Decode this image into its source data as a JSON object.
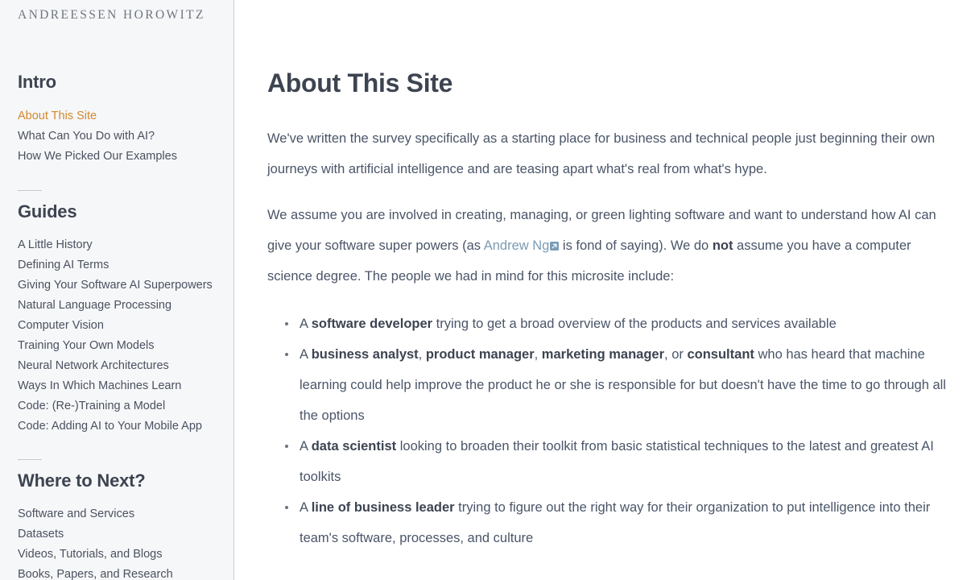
{
  "sidebar": {
    "logo": "ANDREESSEN HOROWITZ",
    "sections": [
      {
        "title": "Intro",
        "items": [
          {
            "label": "About This Site",
            "active": true
          },
          {
            "label": "What Can You Do with AI?",
            "active": false
          },
          {
            "label": "How We Picked Our Examples",
            "active": false
          }
        ]
      },
      {
        "title": "Guides",
        "items": [
          {
            "label": "A Little History",
            "active": false
          },
          {
            "label": "Defining AI Terms",
            "active": false
          },
          {
            "label": "Giving Your Software AI Superpowers",
            "active": false
          },
          {
            "label": "Natural Language Processing",
            "active": false
          },
          {
            "label": "Computer Vision",
            "active": false
          },
          {
            "label": "Training Your Own Models",
            "active": false
          },
          {
            "label": "Neural Network Architectures",
            "active": false
          },
          {
            "label": "Ways In Which Machines Learn",
            "active": false
          },
          {
            "label": "Code: (Re-)Training a Model",
            "active": false
          },
          {
            "label": "Code: Adding AI to Your Mobile App",
            "active": false
          }
        ]
      },
      {
        "title": "Where to Next?",
        "items": [
          {
            "label": "Software and Services",
            "active": false
          },
          {
            "label": "Datasets",
            "active": false
          },
          {
            "label": "Videos, Tutorials, and Blogs",
            "active": false
          },
          {
            "label": "Books, Papers, and Research",
            "active": false
          }
        ]
      }
    ]
  },
  "main": {
    "title": "About This Site",
    "paragraph_1": "We've written the survey specifically as a starting place for business and technical people just beginning their own journeys with artificial intelligence and are teasing apart what's real from what's hype.",
    "paragraph_2": {
      "part_1": "We assume you are involved in creating, managing, or green lighting software and want to understand how AI can give your software super powers (as ",
      "link_text": "Andrew Ng",
      "part_2": " is fond of saying). We do ",
      "emphasis": "not",
      "part_3": " assume you have a computer science degree. The people we had in mind for this microsite include:"
    },
    "bullets": [
      {
        "lead": "A ",
        "role": "software developer",
        "rest": " trying to get a broad overview of the products and services available"
      },
      {
        "lead": "A ",
        "role": "business analyst",
        "role_2": "product manager",
        "role_3": "marketing manager",
        "role_4": "consultant",
        "rest": " who has heard that machine learning could help improve the product he or she is responsible for but doesn't have the time to go through all the options"
      },
      {
        "lead": "A ",
        "role": "data scientist",
        "rest": " looking to broaden their toolkit from basic statistical techniques to the latest and greatest AI toolkits"
      },
      {
        "lead": "A ",
        "role": "line of business leader",
        "rest": " trying to figure out the right way for their organization to put intelligence into their team's software, processes, and culture"
      }
    ]
  },
  "colors": {
    "accent_active": "#d2892c",
    "link": "#7b9bb5",
    "body_text": "#4a5568",
    "heading": "#3d4451",
    "sidebar_bg": "#f6f7f8"
  }
}
